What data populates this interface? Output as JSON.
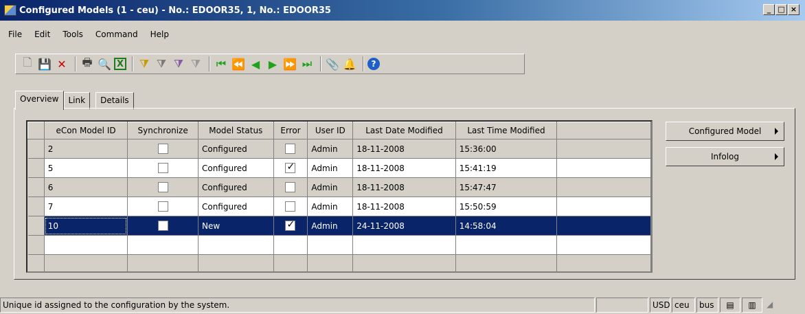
{
  "window": {
    "title": "Configured Models (1 - ceu) - No.: EDOOR35, 1, No.: EDOOR35",
    "min_glyph": "_",
    "max_glyph": "□",
    "close_glyph": "×"
  },
  "menu": [
    "File",
    "Edit",
    "Tools",
    "Command",
    "Help"
  ],
  "toolbar_icons": [
    {
      "name": "new-icon",
      "glyph": "🗋",
      "color": "#808080"
    },
    {
      "name": "save-icon",
      "glyph": "💾",
      "color": "#1a237e"
    },
    {
      "name": "delete-icon",
      "glyph": "✕",
      "color": "#cc0000"
    },
    {
      "sep": true
    },
    {
      "name": "print-icon",
      "glyph": "🖶",
      "color": "#404040"
    },
    {
      "name": "print-preview-icon",
      "glyph": "🔍",
      "color": "#2c5fa8"
    },
    {
      "name": "excel-icon",
      "glyph": "X",
      "color": "#1d7a1d"
    },
    {
      "sep": true
    },
    {
      "name": "filter-by-selection-icon",
      "glyph": "⧩",
      "color": "#c99a00"
    },
    {
      "name": "filter-by-grid-icon",
      "glyph": "⧩",
      "color": "#7b7b7b"
    },
    {
      "name": "advanced-filter-icon",
      "glyph": "⧩",
      "color": "#8a5ca8"
    },
    {
      "name": "remove-filter-icon",
      "glyph": "⧩",
      "color": "#9a9a9a"
    },
    {
      "sep": true
    },
    {
      "name": "first-record-icon",
      "glyph": "⏮",
      "color": "#1fa31f"
    },
    {
      "name": "previous-page-icon",
      "glyph": "⏪",
      "color": "#1fa31f"
    },
    {
      "name": "previous-record-icon",
      "glyph": "◀",
      "color": "#1fa31f"
    },
    {
      "name": "next-record-icon",
      "glyph": "▶",
      "color": "#1fa31f"
    },
    {
      "name": "next-page-icon",
      "glyph": "⏩",
      "color": "#1fa31f"
    },
    {
      "name": "last-record-icon",
      "glyph": "⏭",
      "color": "#1fa31f"
    },
    {
      "sep": true
    },
    {
      "name": "document-handling-icon",
      "glyph": "📎",
      "color": "#404040"
    },
    {
      "name": "alert-icon",
      "glyph": "🔔",
      "color": "#d19a00"
    },
    {
      "sep": true
    },
    {
      "name": "help-icon",
      "glyph": "?",
      "color": "#1f5fc8"
    }
  ],
  "tabs": [
    "Overview",
    "Link",
    "Details"
  ],
  "grid": {
    "columns": [
      "eCon Model ID",
      "Synchronize",
      "Model Status",
      "Error",
      "User ID",
      "Last Date Modified",
      "Last Time Modified"
    ],
    "rows": [
      {
        "id": "2",
        "sync": false,
        "status": "Configured",
        "error": false,
        "user": "Admin",
        "date": "18-11-2008",
        "time": "15:36:00"
      },
      {
        "id": "5",
        "sync": false,
        "status": "Configured",
        "error": true,
        "user": "Admin",
        "date": "18-11-2008",
        "time": "15:41:19"
      },
      {
        "id": "6",
        "sync": false,
        "status": "Configured",
        "error": false,
        "user": "Admin",
        "date": "18-11-2008",
        "time": "15:47:47"
      },
      {
        "id": "7",
        "sync": false,
        "status": "Configured",
        "error": false,
        "user": "Admin",
        "date": "18-11-2008",
        "time": "15:50:59"
      },
      {
        "id": "10",
        "sync": false,
        "status": "New",
        "error": true,
        "user": "Admin",
        "date": "24-11-2008",
        "time": "14:58:04",
        "selected": true
      }
    ],
    "empty_rows": 2
  },
  "side_buttons": [
    "Configured Model",
    "Infolog"
  ],
  "status": {
    "message": "Unique id assigned to the configuration by the system.",
    "currency": "USD",
    "company": "ceu",
    "layer": "bus"
  }
}
